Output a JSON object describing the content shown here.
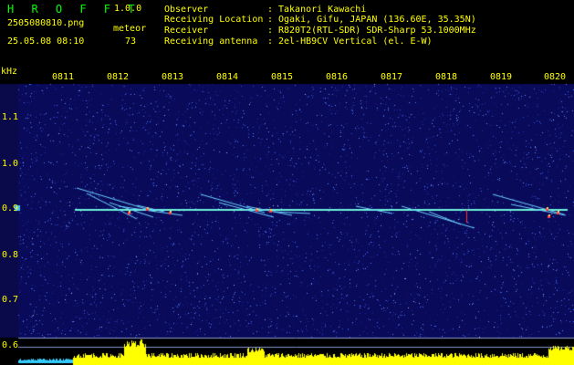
{
  "header": {
    "app_name": "H R O F F T",
    "app_version": "1.0.0",
    "filename": "2505080810.png",
    "datetime": "25.05.08 08:10",
    "meteor_label": "meteor",
    "meteor_count": "73"
  },
  "info": [
    {
      "key": "Observer",
      "value": "Takanori Kawachi"
    },
    {
      "key": "Receiving Location",
      "value": "Ogaki, Gifu, JAPAN (136.60E, 35.35N)"
    },
    {
      "key": "Receiver",
      "value": "R820T2(RTL-SDR) SDR-Sharp 53.1000MHz"
    },
    {
      "key": "Receiving antenna",
      "value": "2el-HB9CV Vertical (el. E-W)"
    }
  ],
  "colon": ":",
  "axis": {
    "unit": "kHz",
    "time_labels": [
      "0811",
      "0812",
      "0813",
      "0814",
      "0815",
      "0816",
      "0817",
      "0818",
      "0819",
      "0820"
    ],
    "freq_labels": [
      "1.1",
      "1.0",
      "0.9",
      "0.8",
      "0.7",
      "0.6"
    ]
  },
  "colors": {
    "background": "#000000",
    "waterfall_base": "#0a0a5a",
    "trace": "#6cf0d8",
    "label": "#ffff00",
    "logo": "#00ff00",
    "histogram": "#ffff00",
    "histogram_left": "#33ccff"
  }
}
